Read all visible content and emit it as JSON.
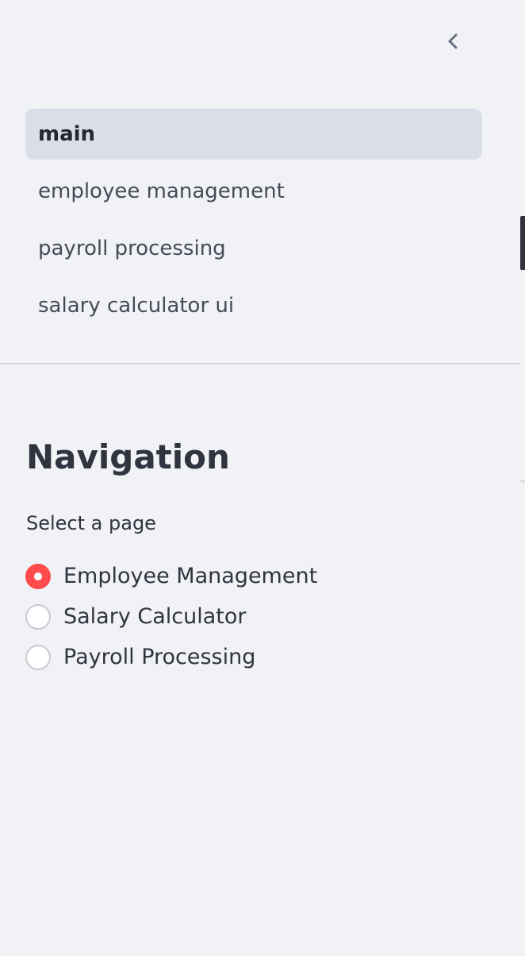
{
  "sidebar": {
    "collapse_icon": "chevron-left-icon",
    "pages": [
      {
        "label": "main",
        "active": true
      },
      {
        "label": "employee management",
        "active": false
      },
      {
        "label": "payroll processing",
        "active": false
      },
      {
        "label": "salary calculator ui",
        "active": false
      }
    ],
    "navigation": {
      "title": "Navigation",
      "radio_label": "Select a page",
      "options": [
        {
          "label": "Employee Management",
          "checked": true
        },
        {
          "label": "Salary Calculator",
          "checked": false
        },
        {
          "label": "Payroll Processing",
          "checked": false
        }
      ]
    }
  },
  "colors": {
    "accent": "#ff4b4b",
    "sidebar_bg": "#f0f2f6",
    "active_item_bg": "#dadee8",
    "text": "#31333f"
  }
}
